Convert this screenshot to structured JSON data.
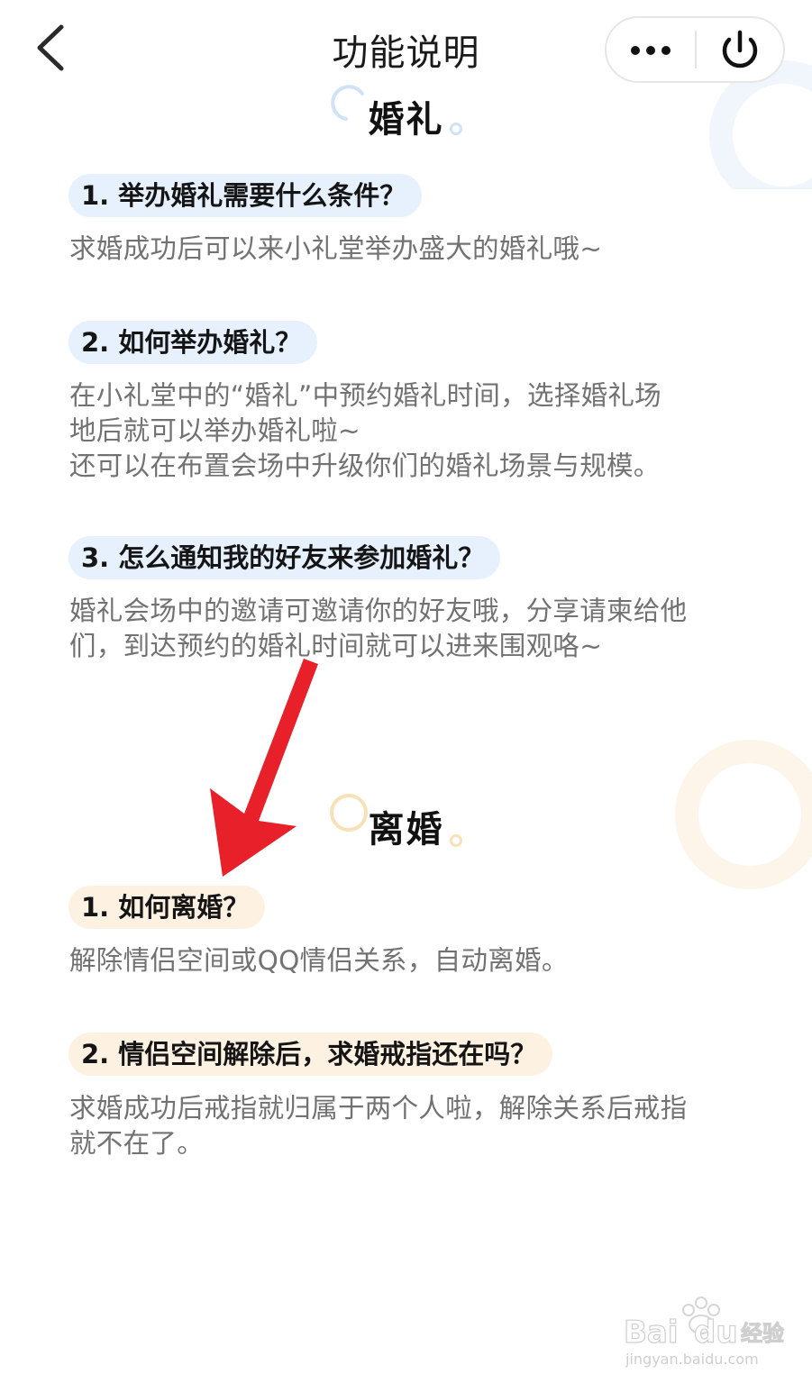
{
  "header": {
    "title": "功能说明",
    "back_icon": "chevron-left-icon",
    "more_icon": "more-dots-icon",
    "power_icon": "power-icon"
  },
  "sections": [
    {
      "heading": "婚礼",
      "accent": "#e6f1fd",
      "items": [
        {
          "question": "1. 举办婚礼需要什么条件？",
          "answer": "求婚成功后可以来小礼堂举办盛大的婚礼哦~"
        },
        {
          "question": "2. 如何举办婚礼？",
          "answer": "在小礼堂中的“婚礼”中预约婚礼时间，选择婚礼场\n地后就可以举办婚礼啦~\n还可以在布置会场中升级你们的婚礼场景与规模。"
        },
        {
          "question": "3. 怎么通知我的好友来参加婚礼？",
          "answer": "婚礼会场中的邀请可邀请你的好友哦，分享请柬给他\n们，到达预约的婚礼时间就可以进来围观咯~"
        }
      ]
    },
    {
      "heading": "离婚",
      "accent": "#fdf1e2",
      "items": [
        {
          "question": "1. 如何离婚？",
          "answer": "解除情侣空间或QQ情侣关系，自动离婚。"
        },
        {
          "question": "2. 情侣空间解除后，求婚戒指还在吗？",
          "answer": "求婚成功后戒指就归属于两个人啦，解除关系后戒指\n就不在了。"
        }
      ]
    }
  ],
  "watermark": {
    "brand": "Baidu经验",
    "url": "jingyan.baidu.com"
  },
  "annotation": {
    "icon": "red-arrow-icon",
    "color": "#e8202a"
  }
}
